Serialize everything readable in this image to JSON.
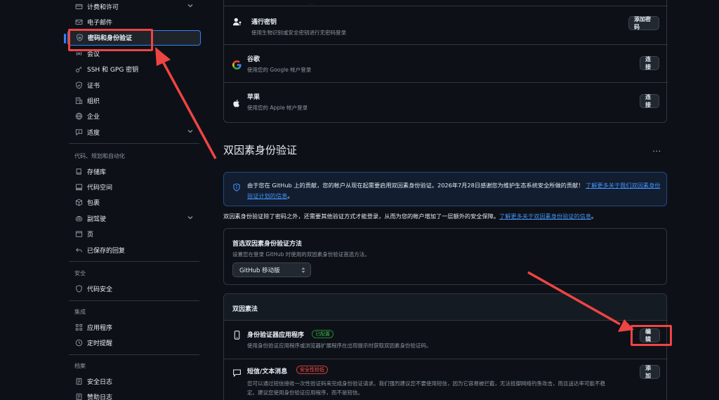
{
  "sidebar": {
    "items_top": [
      {
        "label": "计费和许可",
        "icon": "credit-card-icon",
        "chevron": true
      },
      {
        "label": "电子邮件",
        "icon": "mail-icon",
        "chevron": false
      },
      {
        "label": "密码和身份验证",
        "icon": "shield-lock-icon",
        "chevron": false
      },
      {
        "label": "会议",
        "icon": "broadcast-icon",
        "chevron": false
      },
      {
        "label": "SSH 和 GPG 密钥",
        "icon": "key-icon",
        "chevron": false
      },
      {
        "label": "证书",
        "icon": "verified-icon",
        "chevron": false
      },
      {
        "label": "组织",
        "icon": "organization-icon",
        "chevron": false
      },
      {
        "label": "企业",
        "icon": "globe-icon",
        "chevron": false
      },
      {
        "label": "适度",
        "icon": "report-icon",
        "chevron": true
      }
    ],
    "section_code": "代码、规划和自动化",
    "items_code": [
      {
        "label": "存储库",
        "icon": "repo-icon",
        "chevron": false
      },
      {
        "label": "代码空间",
        "icon": "codespaces-icon",
        "chevron": false
      },
      {
        "label": "包裹",
        "icon": "package-icon",
        "chevron": false
      },
      {
        "label": "副驾驶",
        "icon": "copilot-icon",
        "chevron": true
      },
      {
        "label": "页",
        "icon": "browser-icon",
        "chevron": false
      },
      {
        "label": "已保存的回复",
        "icon": "reply-icon",
        "chevron": false
      }
    ],
    "section_security": "安全",
    "items_security": [
      {
        "label": "代码安全",
        "icon": "shield-icon",
        "chevron": false
      }
    ],
    "section_integrations": "集成",
    "items_integrations": [
      {
        "label": "应用程序",
        "icon": "apps-icon",
        "chevron": false
      },
      {
        "label": "定时提醒",
        "icon": "clock-icon",
        "chevron": false
      }
    ],
    "section_archive": "档案",
    "items_archive": [
      {
        "label": "安全日志",
        "icon": "log-icon",
        "chevron": false
      },
      {
        "label": "赞助日志",
        "icon": "log-icon",
        "chevron": false
      }
    ]
  },
  "login_methods": {
    "top_fragment": "...",
    "passkey": {
      "title": "通行密钥",
      "desc": "使用生物识别或安全密钥进行无密码登录",
      "button": "添加密码"
    },
    "google": {
      "title": "谷歌",
      "desc": "使用您的 Google 帐户登录",
      "button": "连接"
    },
    "apple": {
      "title": "苹果",
      "desc": "使用您的 Apple 帐户登录",
      "button": "连接"
    }
  },
  "two_factor": {
    "title": "双因素身份验证",
    "menu": "...",
    "banner_text": "由于您在 GitHub 上的贡献，您的帐户从现在起需要启用双因素身份验证。2026年7月28日感谢您为维护生态系统安全所做的贡献！",
    "banner_link": "了解更多关于我们双因素身份验证计划的信息",
    "banner_end": "。",
    "para_text": "双因素身份验证除了密码之外，还需要其他验证方式才能登录，从而为您的帐户增加了一层额外的安全保障。",
    "para_link": "了解更多关于双因素身份验证的信息",
    "para_end": "。",
    "preferred": {
      "title": "首选双因素身份验证方法",
      "desc": "设置您在登录 GitHub 时使用的双因素身份验证首选方法。",
      "selected": "GitHub 移动版"
    },
    "methods_header": "双因素法",
    "authenticator": {
      "title": "身份验证器应用程序",
      "badge": "已配置",
      "desc": "使用身份验证应用程序或浏览器扩展程序在出现提示时获取双因素身份验证码。",
      "button": "编辑"
    },
    "sms": {
      "title": "短信/文本消息",
      "badge": "安全性较低",
      "desc_line1": "您可以通过短信接收一次性验证码来完成身份验证请求。我们强烈建议您不要使用短信，因为它容易被拦截，无法抵御网络钓鱼攻击，而且送达率可能不稳",
      "desc_line2": "定。建议您使用身份验证应用程序，而不是短信。",
      "button": "添加"
    }
  },
  "colors": {
    "background": "#0d1117",
    "border": "#30363d",
    "accent": "#2f81f7",
    "annotation": "#ef4444",
    "success": "#3fb950",
    "danger": "#f85149"
  }
}
